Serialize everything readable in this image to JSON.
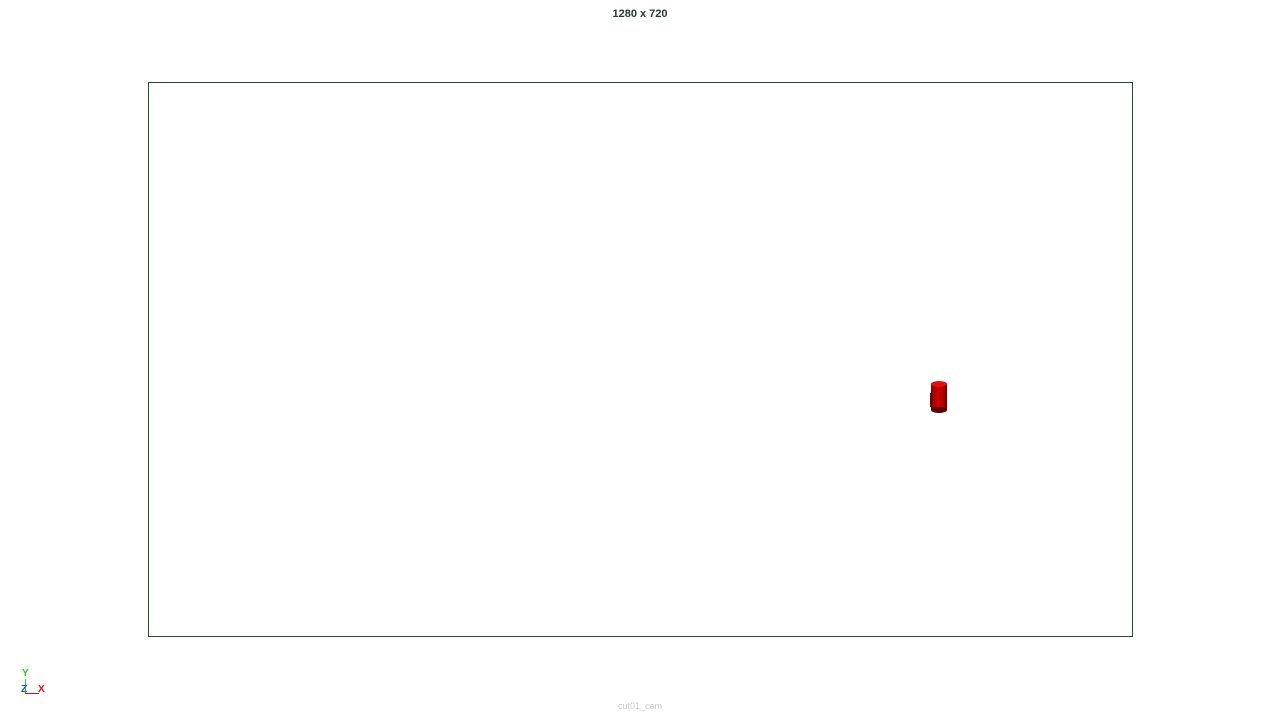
{
  "viewport": {
    "resolution_label": "1280 x 720",
    "camera_name": "cut01_cam"
  },
  "axis_gizmo": {
    "y_label": "Y",
    "z_label": "Z",
    "x_label": "X"
  },
  "scene_objects": [
    {
      "name": "red-cylinder",
      "color": "#cc0000"
    }
  ],
  "colors": {
    "gate_border": "#1f4d2f",
    "y_axis": "#22cc22",
    "z_axis": "#2255cc",
    "x_axis": "#dd1111"
  }
}
